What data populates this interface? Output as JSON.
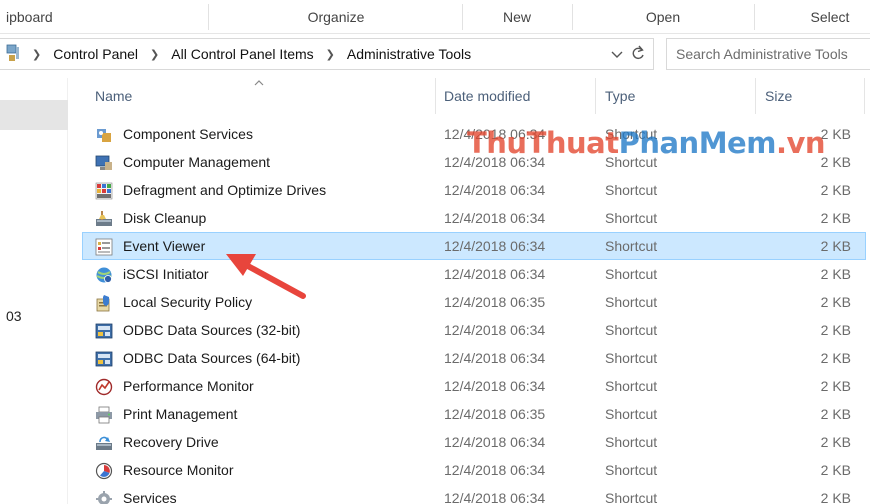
{
  "ribbon": {
    "groups": [
      "ipboard",
      "Organize",
      "New",
      "Open",
      "Select"
    ]
  },
  "address": {
    "breadcrumbs": [
      "Control Panel",
      "All Control Panel Items",
      "Administrative Tools"
    ],
    "search_placeholder": "Search Administrative Tools"
  },
  "nav": {
    "fragment": "03"
  },
  "columns": {
    "name": "Name",
    "date": "Date modified",
    "type": "Type",
    "size": "Size"
  },
  "files": [
    {
      "name": "Component Services",
      "date": "12/4/2018 06:34",
      "type": "Shortcut",
      "size": "2 KB",
      "icon": "component-services-icon"
    },
    {
      "name": "Computer Management",
      "date": "12/4/2018 06:34",
      "type": "Shortcut",
      "size": "2 KB",
      "icon": "computer-management-icon"
    },
    {
      "name": "Defragment and Optimize Drives",
      "date": "12/4/2018 06:34",
      "type": "Shortcut",
      "size": "2 KB",
      "icon": "defragment-icon"
    },
    {
      "name": "Disk Cleanup",
      "date": "12/4/2018 06:34",
      "type": "Shortcut",
      "size": "2 KB",
      "icon": "disk-cleanup-icon"
    },
    {
      "name": "Event Viewer",
      "date": "12/4/2018 06:34",
      "type": "Shortcut",
      "size": "2 KB",
      "icon": "event-viewer-icon",
      "selected": true
    },
    {
      "name": "iSCSI Initiator",
      "date": "12/4/2018 06:34",
      "type": "Shortcut",
      "size": "2 KB",
      "icon": "iscsi-globe-icon"
    },
    {
      "name": "Local Security Policy",
      "date": "12/4/2018 06:35",
      "type": "Shortcut",
      "size": "2 KB",
      "icon": "security-policy-icon"
    },
    {
      "name": "ODBC Data Sources (32-bit)",
      "date": "12/4/2018 06:34",
      "type": "Shortcut",
      "size": "2 KB",
      "icon": "odbc-icon"
    },
    {
      "name": "ODBC Data Sources (64-bit)",
      "date": "12/4/2018 06:34",
      "type": "Shortcut",
      "size": "2 KB",
      "icon": "odbc-icon"
    },
    {
      "name": "Performance Monitor",
      "date": "12/4/2018 06:34",
      "type": "Shortcut",
      "size": "2 KB",
      "icon": "performance-monitor-icon"
    },
    {
      "name": "Print Management",
      "date": "12/4/2018 06:35",
      "type": "Shortcut",
      "size": "2 KB",
      "icon": "print-management-icon"
    },
    {
      "name": "Recovery Drive",
      "date": "12/4/2018 06:34",
      "type": "Shortcut",
      "size": "2 KB",
      "icon": "recovery-drive-icon"
    },
    {
      "name": "Resource Monitor",
      "date": "12/4/2018 06:34",
      "type": "Shortcut",
      "size": "2 KB",
      "icon": "resource-monitor-icon"
    },
    {
      "name": "Services",
      "date": "12/4/2018 06:34",
      "type": "Shortcut",
      "size": "2 KB",
      "icon": "services-gear-icon"
    }
  ],
  "watermark": {
    "part1": "ThuThuat",
    "part2": "PhanMem",
    "part3": ".vn"
  },
  "colors": {
    "selection_fill": "#cce8ff",
    "selection_border": "#99d1ff",
    "arrow": "#e8453c",
    "header_text": "#4c607a"
  }
}
